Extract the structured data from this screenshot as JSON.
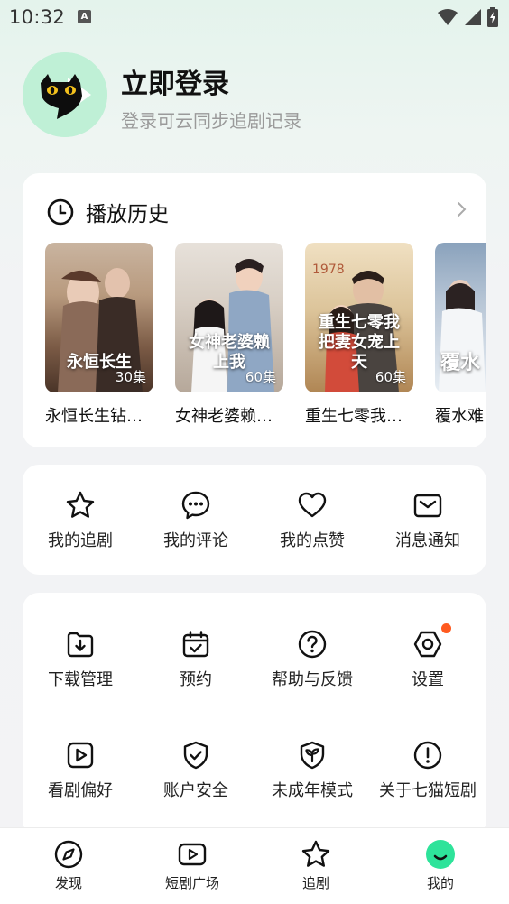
{
  "status_bar": {
    "time": "10:32",
    "app_badge": "A",
    "icons": [
      "wifi-icon",
      "signal-icon",
      "battery-charging-icon"
    ]
  },
  "profile": {
    "title": "立即登录",
    "subtitle": "登录可云同步追剧记录",
    "avatar_icon": "black-cat-play-logo",
    "avatar_bg": "#bff0d6"
  },
  "history": {
    "title": "播放历史",
    "items": [
      {
        "title": "永恒长生钻…",
        "episodes": "30集",
        "cover_text": "永恒长生"
      },
      {
        "title": "女神老婆赖…",
        "episodes": "60集",
        "cover_text": "女神老婆赖上我"
      },
      {
        "title": "重生七零我…",
        "episodes": "60集",
        "cover_text": "重生七零我把妻女宠上天"
      },
      {
        "title": "覆水难",
        "episodes": "",
        "cover_text": "覆水"
      }
    ]
  },
  "quick_actions": [
    {
      "label": "我的追剧",
      "icon": "star-icon"
    },
    {
      "label": "我的评论",
      "icon": "comment-icon"
    },
    {
      "label": "我的点赞",
      "icon": "heart-icon"
    },
    {
      "label": "消息通知",
      "icon": "mail-icon"
    }
  ],
  "tools": [
    {
      "label": "下载管理",
      "icon": "download-folder-icon"
    },
    {
      "label": "预约",
      "icon": "calendar-check-icon"
    },
    {
      "label": "帮助与反馈",
      "icon": "help-icon"
    },
    {
      "label": "设置",
      "icon": "settings-hex-icon",
      "badge": true
    },
    {
      "label": "看剧偏好",
      "icon": "play-preference-icon"
    },
    {
      "label": "账户安全",
      "icon": "shield-check-icon"
    },
    {
      "label": "未成年模式",
      "icon": "sprout-shield-icon"
    },
    {
      "label": "关于七猫短剧",
      "icon": "info-icon"
    }
  ],
  "bottom_nav": [
    {
      "label": "发现",
      "icon": "compass-icon",
      "active": false
    },
    {
      "label": "短剧广场",
      "icon": "play-square-icon",
      "active": false
    },
    {
      "label": "追剧",
      "icon": "star-outline-icon",
      "active": false
    },
    {
      "label": "我的",
      "icon": "smile-face-icon",
      "active": true
    }
  ],
  "colors": {
    "accent": "#2ee39a",
    "badge": "#ff5a1f",
    "background_top": "#e4f3ec"
  }
}
